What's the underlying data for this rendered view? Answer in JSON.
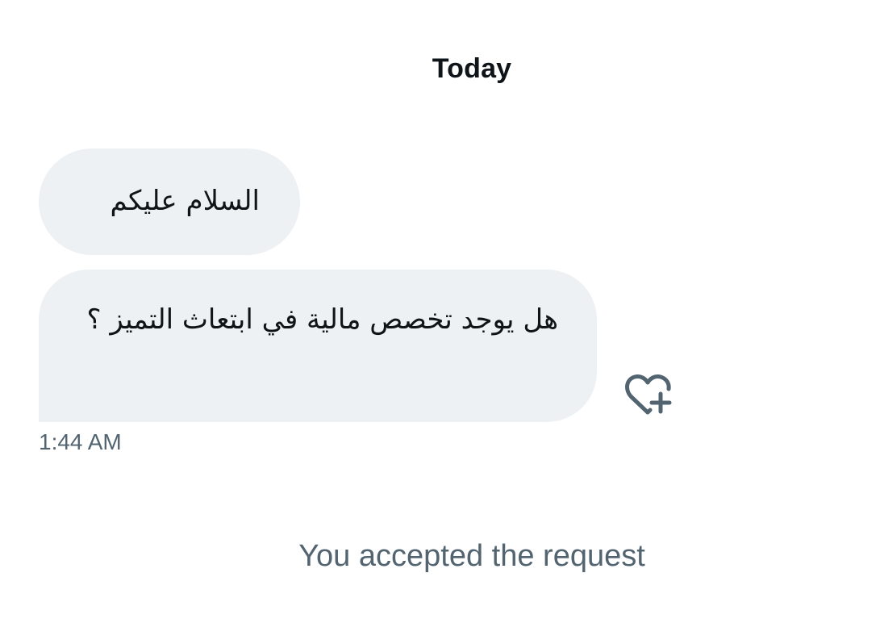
{
  "conversation": {
    "date_header": "Today",
    "messages": [
      {
        "text": "السلام عليكم"
      },
      {
        "text": "هل يوجد تخصص مالية في ابتعاث التميز ؟"
      }
    ],
    "timestamp": "1:44 AM",
    "reaction_icon": "heart-plus-icon",
    "system_message": "You accepted the request"
  },
  "colors": {
    "bubble_bg": "#eef1f3",
    "text_primary": "#0f1419",
    "text_secondary": "#536471"
  }
}
